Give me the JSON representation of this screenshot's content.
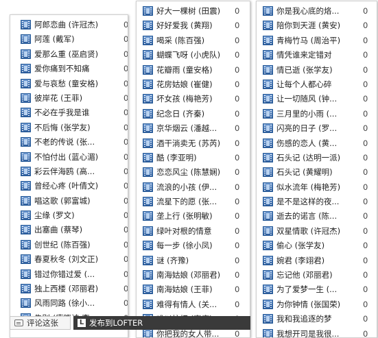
{
  "columns": [
    {
      "songs": [
        {
          "title": "阿郎恋曲 (许冠杰)",
          "count": "0"
        },
        {
          "title": "阿莲 (戴军)",
          "count": "0"
        },
        {
          "title": "爱那么重 (巫启贤)",
          "count": "0"
        },
        {
          "title": "爱你痛到不知痛",
          "count": "0"
        },
        {
          "title": "爱与哀愁 (童安格)",
          "count": "0"
        },
        {
          "title": "彼岸花 (王菲)",
          "count": "0"
        },
        {
          "title": "不必在乎我是谁",
          "count": "0"
        },
        {
          "title": "不后悔 (张学友)",
          "count": "0"
        },
        {
          "title": "不老的传说 (张...",
          "count": "0"
        },
        {
          "title": "不怕付出 (蓝心湄)",
          "count": "0"
        },
        {
          "title": "彩云伴海鸥 (高...",
          "count": "0"
        },
        {
          "title": "曾经心疼 (叶倩文)",
          "count": "0"
        },
        {
          "title": "唱这歌 (郭富城)",
          "count": "0"
        },
        {
          "title": "尘缘 (罗文)",
          "count": "0"
        },
        {
          "title": "出塞曲 (蔡琴)",
          "count": "0"
        },
        {
          "title": "创世纪 (陈百强)",
          "count": "0"
        },
        {
          "title": "春夏秋冬 (刘文正)",
          "count": "0"
        },
        {
          "title": "错过你错过爱 (...",
          "count": "0"
        },
        {
          "title": "独上西楼 (邓丽君)",
          "count": "0"
        },
        {
          "title": "风雨同路 (徐小...",
          "count": "0"
        },
        {
          "title": "告别 (唐晓诗 李...",
          "count": "0"
        }
      ]
    },
    {
      "songs": [
        {
          "title": "好大一棵树 (田震)",
          "count": "0"
        },
        {
          "title": "好好爱我 (黄翔)",
          "count": "0"
        },
        {
          "title": "喝采 (陈百强)",
          "count": "0"
        },
        {
          "title": "蝴蝶飞呀 (小虎队)",
          "count": "0"
        },
        {
          "title": "花瓣雨 (童安格)",
          "count": "0"
        },
        {
          "title": "花房姑娘 (崔健)",
          "count": "0"
        },
        {
          "title": "坏女孩 (梅艳芳)",
          "count": "0"
        },
        {
          "title": "纪念日 (齐秦)",
          "count": "0"
        },
        {
          "title": "京华烟云 (潘越...",
          "count": "0"
        },
        {
          "title": "酒干淌卖无 (苏芮)",
          "count": "0"
        },
        {
          "title": "酷 (李亚明)",
          "count": "0"
        },
        {
          "title": "恋恋风尘 (陈慧娴)",
          "count": "0"
        },
        {
          "title": "流浪的小孩 (伊...",
          "count": "0"
        },
        {
          "title": "流星下的愿 (张...",
          "count": "0"
        },
        {
          "title": "垄上行 (张明敏)",
          "count": "0"
        },
        {
          "title": "绿叶对根的情意",
          "count": "0"
        },
        {
          "title": "每一步 (徐小凤)",
          "count": "0"
        },
        {
          "title": "谜 (齐豫)",
          "count": "0"
        },
        {
          "title": "南海姑娘 (邓丽君)",
          "count": "0"
        },
        {
          "title": "南海姑娘 (王菲)",
          "count": "0"
        },
        {
          "title": "难得有情人 (关...",
          "count": "0"
        },
        {
          "title": "难以抗拒 (李度)",
          "count": "0"
        },
        {
          "title": "你把我的女人带...",
          "count": "0"
        }
      ]
    },
    {
      "songs": [
        {
          "title": "你是我心底的烙...",
          "count": "0"
        },
        {
          "title": "陪你到天涯 (黄安)",
          "count": "0"
        },
        {
          "title": "青梅竹马 (周治平)",
          "count": "0"
        },
        {
          "title": "情凭谁来定错对",
          "count": "0"
        },
        {
          "title": "情已逝 (张学友)",
          "count": "0"
        },
        {
          "title": "让每个人都心碎",
          "count": "0"
        },
        {
          "title": "让一切随风 (钟...",
          "count": "0"
        },
        {
          "title": "三月里的小雨 (...",
          "count": "0"
        },
        {
          "title": "闪亮的日子 (罗...",
          "count": "0"
        },
        {
          "title": "伤感的恋人 (黄...",
          "count": "0"
        },
        {
          "title": "石头记 (达明一派)",
          "count": "0"
        },
        {
          "title": "石头记 (黄耀明)",
          "count": "0"
        },
        {
          "title": "似水流年 (梅艳芳)",
          "count": "0"
        },
        {
          "title": "是不是这样的夜...",
          "count": "0"
        },
        {
          "title": "逝去的诺言 (陈...",
          "count": "0"
        },
        {
          "title": "双星情歌 (许冠杰)",
          "count": "0"
        },
        {
          "title": "偷心 (张学友)",
          "count": "0"
        },
        {
          "title": "婉君 (李翊君)",
          "count": "0"
        },
        {
          "title": "忘记他 (邓丽君)",
          "count": "0"
        },
        {
          "title": "为了爱梦一生 (...",
          "count": "0"
        },
        {
          "title": "为你钟情 (张国荣)",
          "count": "0"
        },
        {
          "title": "我和我追逐的梦",
          "count": "0"
        },
        {
          "title": "我想开司是我很...",
          "count": "0"
        }
      ]
    }
  ],
  "bottom_bar": {
    "comment_label": "评论这张",
    "lofter_icon": "L",
    "lofter_label": "发布到LOFTER"
  },
  "icons": {
    "song": "film-strip-icon",
    "comment": "comment-icon",
    "lofter": "lofter-logo-icon"
  },
  "colors": {
    "song_icon": "#2c5c9c",
    "lofter_bar": "#3a3a3a"
  }
}
